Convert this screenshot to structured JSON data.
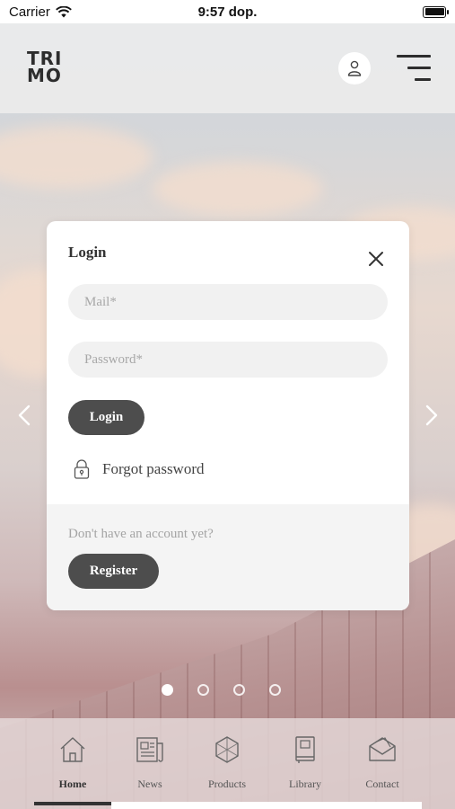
{
  "status_bar": {
    "carrier": "Carrier",
    "time": "9:57 dop."
  },
  "header": {
    "logo_line1": "TRI",
    "logo_line2": "MO",
    "account_icon": "user-icon",
    "menu_icon": "hamburger-menu-icon"
  },
  "carousel": {
    "dot_count": 4,
    "active_dot": 0
  },
  "login": {
    "title": "Login",
    "mail_placeholder": "Mail*",
    "password_placeholder": "Password*",
    "login_button": "Login",
    "forgot_password": "Forgot password",
    "no_account_text": "Don't have an account yet?",
    "register_button": "Register"
  },
  "tabs": [
    {
      "label": "Home",
      "icon": "home-icon",
      "active": true
    },
    {
      "label": "News",
      "icon": "news-icon",
      "active": false
    },
    {
      "label": "Products",
      "icon": "products-icon",
      "active": false
    },
    {
      "label": "Library",
      "icon": "library-icon",
      "active": false
    },
    {
      "label": "Contact",
      "icon": "contact-icon",
      "active": false
    }
  ],
  "colors": {
    "button_dark": "#4d4d4d",
    "field_bg": "#f1f1f1",
    "header_bg": "#ececec"
  }
}
